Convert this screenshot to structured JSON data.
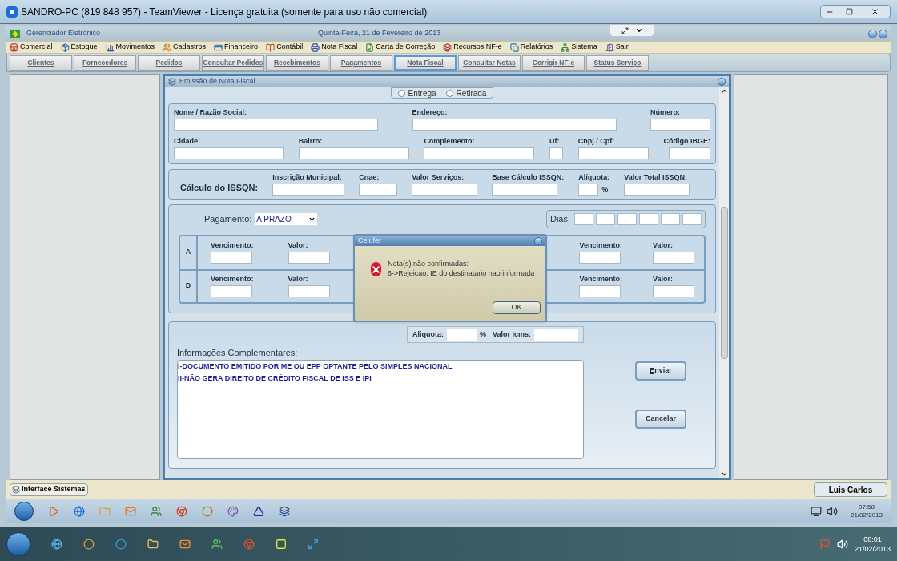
{
  "teamviewer": {
    "title": "SANDRO-PC (819 848 957) - TeamViewer - Licença gratuita (somente para uso não comercial)"
  },
  "app": {
    "title": "Gerenciador Eletrônico",
    "date": "Quinta-Feira, 21 de Fevereiro de 2013"
  },
  "menu": [
    {
      "label": "Comercial"
    },
    {
      "label": "Estoque"
    },
    {
      "label": "Movimentos"
    },
    {
      "label": "Cadastros"
    },
    {
      "label": "Financeiro"
    },
    {
      "label": "Contábil"
    },
    {
      "label": "Nota Fiscal"
    },
    {
      "label": "Carta de Correção"
    },
    {
      "label": "Recursos NF-e"
    },
    {
      "label": "Relatórios"
    },
    {
      "label": "Sistema"
    },
    {
      "label": "Sair"
    }
  ],
  "shortcuts": [
    {
      "label": "Clientes",
      "selected": false
    },
    {
      "label": "Fornecedores",
      "selected": false
    },
    {
      "label": "Pedidos",
      "selected": false
    },
    {
      "label": "Consultar Pedidos",
      "selected": false
    },
    {
      "label": "Recebimentos",
      "selected": false
    },
    {
      "label": "Pagamentos",
      "selected": false
    },
    {
      "label": "Nota Fiscal",
      "selected": true
    },
    {
      "label": "Consultar Notas",
      "selected": false
    },
    {
      "label": "Corrigir NF-e",
      "selected": false
    },
    {
      "label": "Status Serviço",
      "selected": false
    }
  ],
  "form": {
    "title": "Emissão de Nota Fiscal",
    "delivery_options": [
      {
        "label": "Entrega",
        "selected": false
      },
      {
        "label": "Retirada",
        "selected": false
      }
    ],
    "address_rows": [
      [
        {
          "label": "Nome / Razão Social:"
        },
        {
          "label": "Endereço:"
        },
        {
          "label": "Número:"
        }
      ],
      [
        {
          "label": "Cidade:"
        },
        {
          "label": "Bairro:"
        },
        {
          "label": "Complemento:"
        },
        {
          "label": "Uf:"
        },
        {
          "label": "Cnpj / Cpf:"
        },
        {
          "label": "Código IBGE:"
        }
      ]
    ],
    "issqn": {
      "title": "Cálculo do ISSQN:",
      "fields": [
        {
          "label": "Inscrição Municipal:"
        },
        {
          "label": "Cnae:"
        },
        {
          "label": "Valor Serviços:"
        },
        {
          "label": "Base Cálculo ISSQN:"
        },
        {
          "label": "Alíquota:",
          "suffix": "%"
        },
        {
          "label": "Valor Total ISSQN:"
        }
      ]
    },
    "payment": {
      "label": "Pagamento:",
      "value": "A PRAZO",
      "days_label": "Dias:",
      "rows": [
        {
          "label": "A",
          "left": [
            {
              "label": "Vencimento:"
            },
            {
              "label": "Valor:"
            }
          ],
          "right": [
            {
              "label": "Vencimento:"
            },
            {
              "label": "Valor:"
            }
          ]
        },
        {
          "label": "D",
          "left": [
            {
              "label": "Vencimento:"
            },
            {
              "label": "Valor:"
            }
          ],
          "right": [
            {
              "label": "Vencimento:"
            },
            {
              "label": "Valor:"
            }
          ]
        }
      ]
    },
    "icms": {
      "aliquota_label": "Aliquota:",
      "percent": "%",
      "valor_label": "Valor Icms:"
    },
    "notes": {
      "label": "Informações Complementares:",
      "lines": [
        "I-DOCUMENTO EMITIDO POR ME OU EPP OPTANTE PELO SIMPLES NACIONAL",
        "II-NÃO GERA DIREITO DE CRÉDITO FISCAL DE ISS E IPI"
      ]
    },
    "buttons": [
      {
        "label": "Enviar"
      },
      {
        "label": "Cancelar"
      }
    ]
  },
  "dialog": {
    "title": "Celufer",
    "lines": [
      "Nota(s) não confirmadas:",
      "6->Rejeicao: IE do destinatario nao informada"
    ],
    "button": "OK"
  },
  "status_bar": {
    "left": "Interface Sistemas",
    "right": "Luis Carlos"
  },
  "remote_taskbar": {
    "time": "07:58",
    "date": "21/02/2013"
  },
  "local_taskbar": {
    "time": "08:01",
    "date": "21/02/2013"
  }
}
